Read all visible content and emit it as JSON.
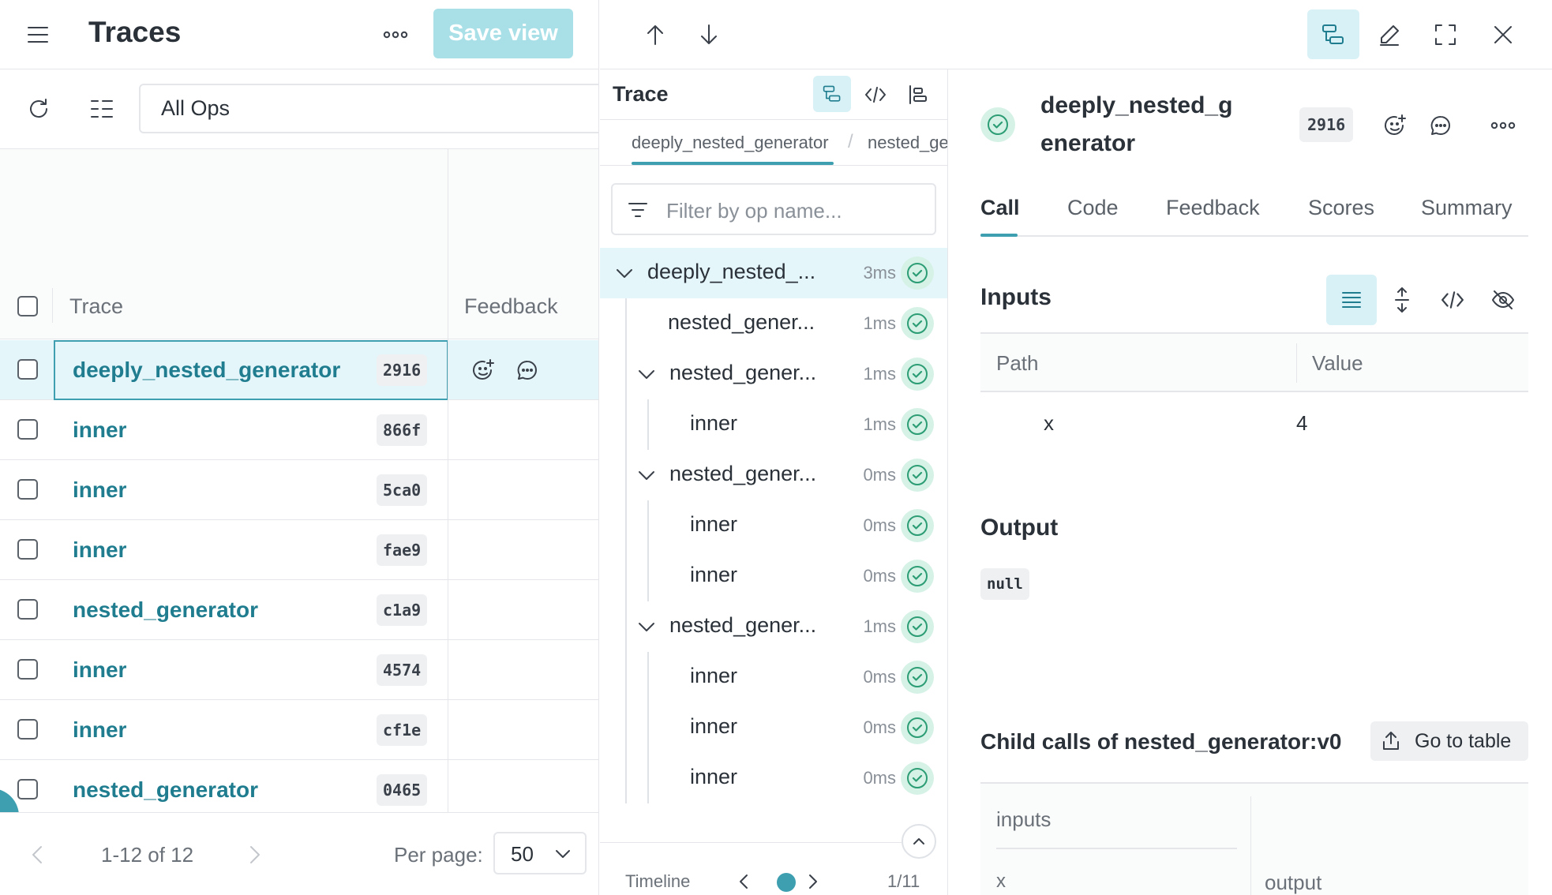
{
  "left_panel": {
    "title": "Traces",
    "save_view_label": "Save view",
    "filter_value": "All Ops",
    "columns": {
      "trace": "Trace",
      "feedback": "Feedback"
    },
    "rows": [
      {
        "name": "deeply_nested_generator",
        "hash": "2916",
        "selected": true
      },
      {
        "name": "inner",
        "hash": "866f"
      },
      {
        "name": "inner",
        "hash": "5ca0"
      },
      {
        "name": "inner",
        "hash": "fae9"
      },
      {
        "name": "nested_generator",
        "hash": "c1a9"
      },
      {
        "name": "inner",
        "hash": "4574"
      },
      {
        "name": "inner",
        "hash": "cf1e"
      },
      {
        "name": "nested_generator",
        "hash": "0465"
      }
    ],
    "pagination": {
      "range": "1-12 of 12",
      "per_page_label": "Per page:",
      "per_page_value": "50"
    }
  },
  "trace_panel": {
    "title": "Trace",
    "breadcrumbs": [
      "deeply_nested_generator",
      "nested_ge"
    ],
    "filter_placeholder": "Filter by op name...",
    "nodes": [
      {
        "name": "deeply_nested_...",
        "duration": "3ms",
        "depth": 0,
        "expanded": true
      },
      {
        "name": "nested_gener...",
        "duration": "1ms",
        "depth": 1
      },
      {
        "name": "nested_gener...",
        "duration": "1ms",
        "depth": 1,
        "expanded": true
      },
      {
        "name": "inner",
        "duration": "1ms",
        "depth": 2
      },
      {
        "name": "nested_gener...",
        "duration": "0ms",
        "depth": 1,
        "expanded": true
      },
      {
        "name": "inner",
        "duration": "0ms",
        "depth": 2
      },
      {
        "name": "inner",
        "duration": "0ms",
        "depth": 2
      },
      {
        "name": "nested_gener...",
        "duration": "1ms",
        "depth": 1,
        "expanded": true
      },
      {
        "name": "inner",
        "duration": "0ms",
        "depth": 2
      },
      {
        "name": "inner",
        "duration": "0ms",
        "depth": 2
      },
      {
        "name": "inner",
        "duration": "0ms",
        "depth": 2
      }
    ],
    "timeline_label": "Timeline",
    "timeline_position": "1/11"
  },
  "detail_panel": {
    "title_line1": "deeply_nested_g",
    "title_line2": "enerator",
    "hash": "2916",
    "tabs": [
      "Call",
      "Code",
      "Feedback",
      "Scores",
      "Summary"
    ],
    "active_tab": "Call",
    "inputs_title": "Inputs",
    "inputs_columns": {
      "path": "Path",
      "value": "Value"
    },
    "inputs_rows": [
      {
        "path": "x",
        "value": "4"
      }
    ],
    "output_title": "Output",
    "output_value": "null",
    "child_calls_title": "Child calls of nested_generator:v0",
    "go_to_table_label": "Go to table",
    "child_table": {
      "header": "inputs",
      "col_x": "x",
      "col_output": "output"
    }
  },
  "colors": {
    "accent": "#1f7d8f",
    "selected_bg": "#e4f6fa",
    "success": "#2c9d74",
    "save_button": "#a9e0e8"
  }
}
